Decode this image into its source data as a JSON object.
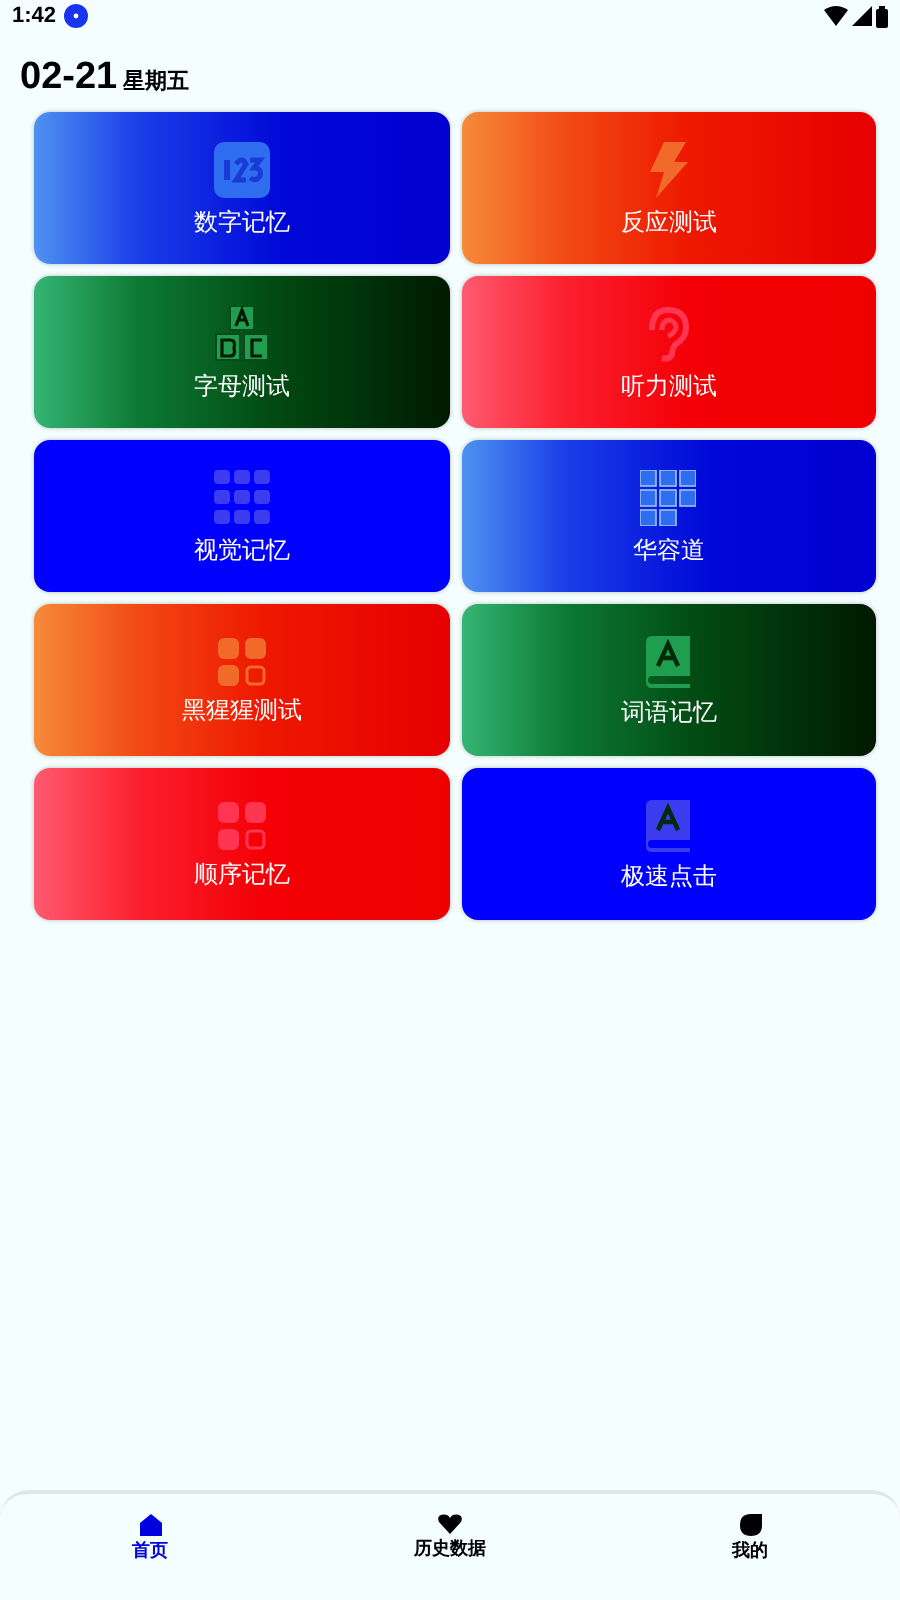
{
  "status_bar": {
    "time": "1:42"
  },
  "header": {
    "date": "02-21",
    "weekday": "星期五"
  },
  "cards": [
    {
      "label": "数字记忆"
    },
    {
      "label": "反应测试"
    },
    {
      "label": "字母测试"
    },
    {
      "label": "听力测试"
    },
    {
      "label": "视觉记忆"
    },
    {
      "label": "华容道"
    },
    {
      "label": "黑猩猩测试"
    },
    {
      "label": "词语记忆"
    },
    {
      "label": "顺序记忆"
    },
    {
      "label": "极速点击"
    }
  ],
  "nav": [
    {
      "label": "首页",
      "selected": true
    },
    {
      "label": "历史数据",
      "selected": false
    },
    {
      "label": "我的",
      "selected": false
    }
  ]
}
